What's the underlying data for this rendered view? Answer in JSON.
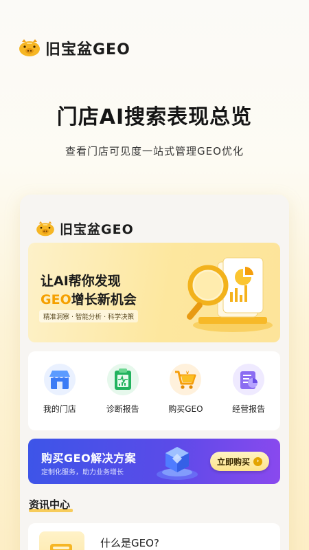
{
  "brand": {
    "name": "旧宝盆GEO"
  },
  "hero": {
    "title": "门店AI搜索表现总览",
    "subtitle": "查看门店可见度一站式管理GEO优化"
  },
  "app": {
    "brand_name": "旧宝盆GEO",
    "banner": {
      "line1": "让AI帮你发现",
      "line2_accent": "GEO",
      "line2_rest": "增长新机会",
      "tags": "精准洞察 · 智能分析 · 科学决策"
    },
    "menu": [
      {
        "label": "我的门店",
        "icon": "store-icon"
      },
      {
        "label": "诊断报告",
        "icon": "diagnosis-report-icon"
      },
      {
        "label": "购买GEO",
        "icon": "shopping-cart-icon"
      },
      {
        "label": "经营报告",
        "icon": "business-report-icon"
      }
    ],
    "promo": {
      "title": "购买GEO解决方案",
      "subtitle": "定制化服务，助力业务增长",
      "button_label": "立即购买"
    },
    "news": {
      "section_title": "资讯中心",
      "items": [
        {
          "title": "什么是GEO?"
        }
      ]
    }
  },
  "colors": {
    "accent_yellow": "#f5a000",
    "promo_blue": "#3d55e8",
    "promo_purple": "#8a49ee"
  }
}
